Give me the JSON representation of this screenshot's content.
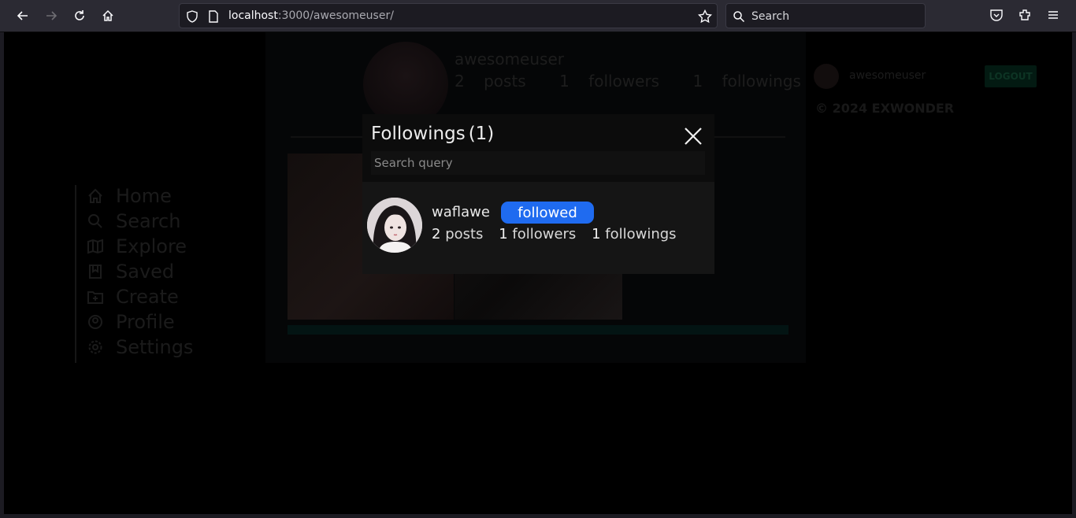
{
  "browser": {
    "url_host": "localhost",
    "url_path": ":3000/awesomeuser/",
    "search_placeholder": "Search"
  },
  "sidebar": {
    "items": [
      {
        "label": "Home",
        "icon": "home-icon"
      },
      {
        "label": "Search",
        "icon": "search-icon"
      },
      {
        "label": "Explore",
        "icon": "map-icon"
      },
      {
        "label": "Saved",
        "icon": "bookmark-icon"
      },
      {
        "label": "Create",
        "icon": "folder-plus-icon"
      },
      {
        "label": "Profile",
        "icon": "user-circle-icon"
      },
      {
        "label": "Settings",
        "icon": "gear-icon"
      }
    ]
  },
  "profile": {
    "username": "awesomeuser",
    "posts_count": "2",
    "posts_label": "posts",
    "followers_count": "1",
    "followers_label": "followers",
    "followings_count": "1",
    "followings_label": "followings"
  },
  "right_panel": {
    "username": "awesomeuser",
    "logout_label": "LOGOUT",
    "copyright": "© 2024 EXWONDER"
  },
  "modal": {
    "title": "Followings",
    "count": "(1)",
    "search_placeholder": "Search query",
    "users": [
      {
        "username": "waflawe",
        "badge": "followed",
        "posts_count": "2",
        "posts_label": "posts",
        "followers_count": "1",
        "followers_label": "followers",
        "followings_count": "1",
        "followings_label": "followings"
      }
    ]
  },
  "colors": {
    "accent": "#1f6bf0",
    "modal_header": "#0c0c0c",
    "modal_body": "#151515"
  }
}
